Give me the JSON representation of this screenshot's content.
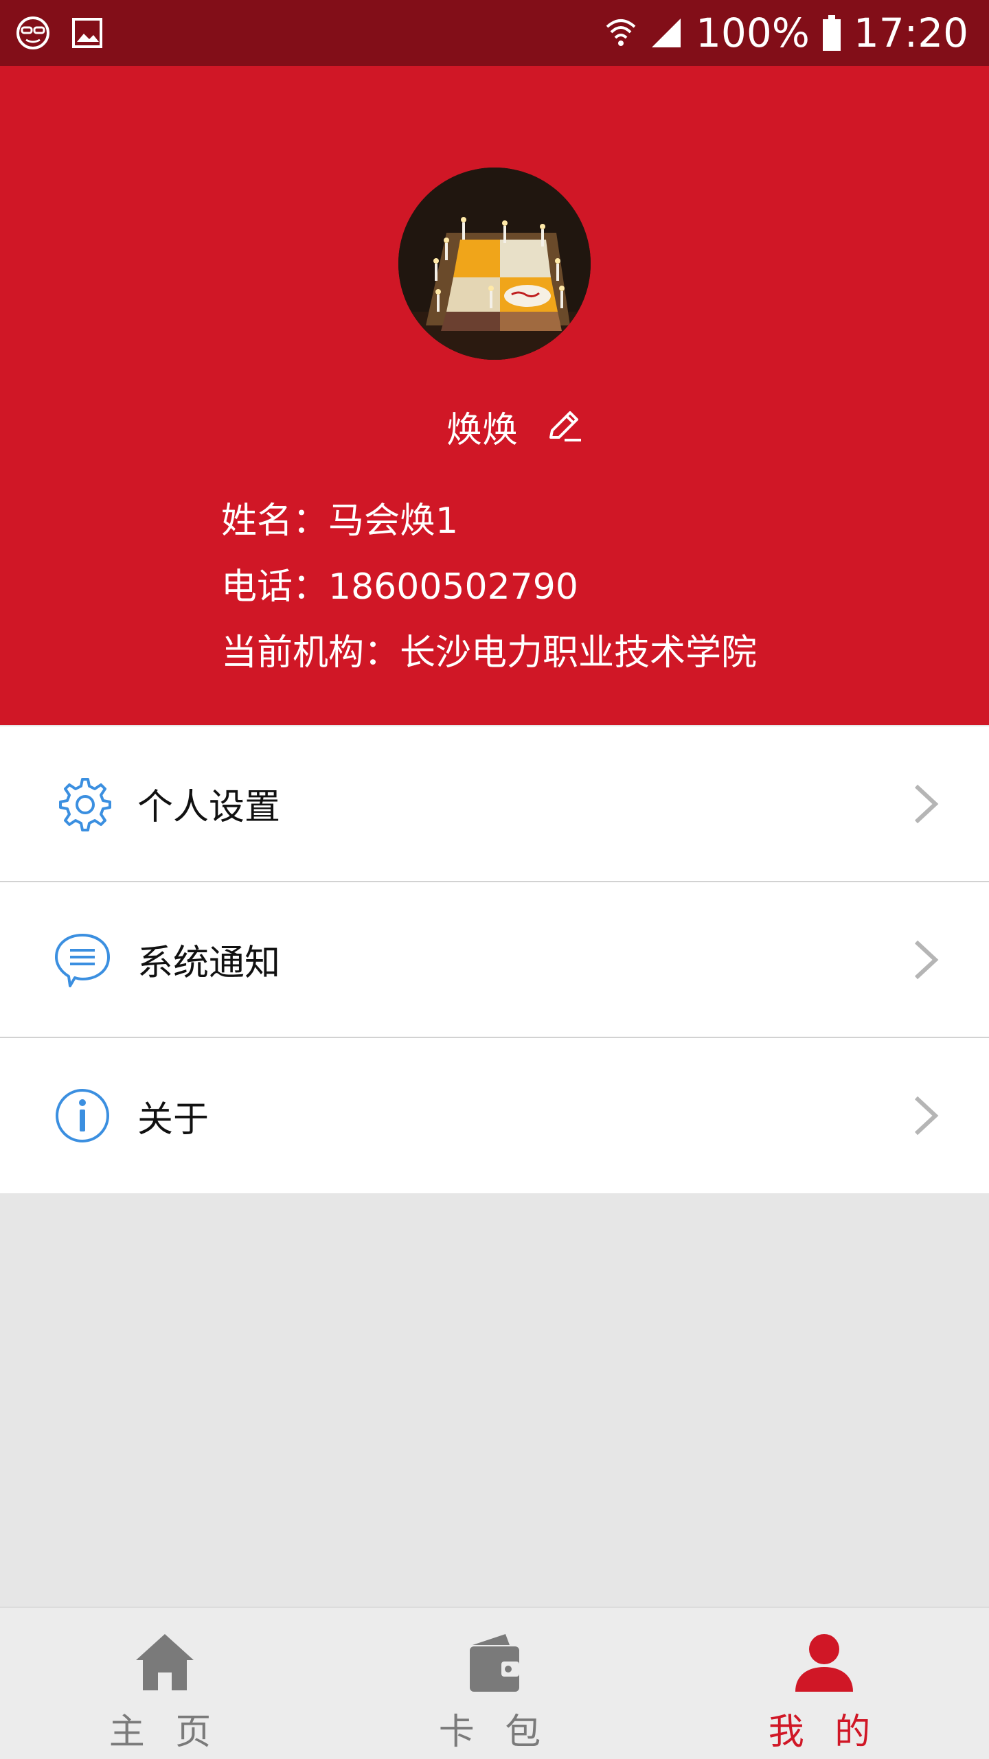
{
  "status_bar": {
    "battery": "100%",
    "time": "17:20"
  },
  "profile": {
    "nickname": "焕焕",
    "name_line": "姓名：马会焕1",
    "phone_line": "电话：18600502790",
    "org_line": "当前机构：长沙电力职业技术学院"
  },
  "menu": {
    "items": [
      {
        "label": "个人设置",
        "icon": "gear-icon"
      },
      {
        "label": "系统通知",
        "icon": "chat-bubble-icon"
      },
      {
        "label": "关于",
        "icon": "info-icon"
      }
    ]
  },
  "bottom_nav": {
    "tabs": [
      {
        "label": "主 页",
        "icon": "home-icon"
      },
      {
        "label": "卡 包",
        "icon": "wallet-icon"
      },
      {
        "label": "我 的",
        "icon": "person-icon"
      }
    ],
    "active_index": 2
  },
  "colors": {
    "header_red": "#d01726",
    "status_bar": "#820e18",
    "accent_blue": "#3b8fe0",
    "inactive_gray": "#7a7a7a"
  }
}
